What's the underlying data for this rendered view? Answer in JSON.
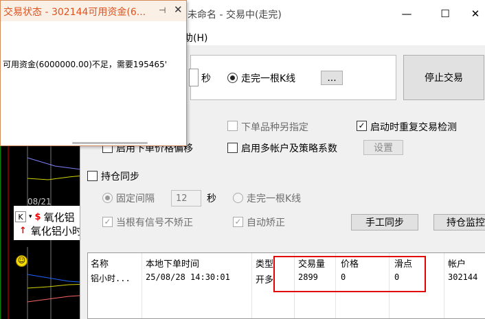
{
  "popup": {
    "title": "交易状态 - 302144可用资金(6...",
    "pin_glyph": "⊣",
    "close_glyph": "✕",
    "message": "可用资金(6000000.00)不足，需要195465'"
  },
  "main": {
    "title": "未命名 - 交易中(走完)",
    "menu_help": "助(H)",
    "minimize_glyph": "—",
    "maximize_glyph": "☐",
    "close_glyph": "✕",
    "sec_label": "秒",
    "bar_complete_label": "走完一根K线",
    "more_button": "...",
    "stop_button": "停止交易",
    "order_variety_label": "下单品种另指定",
    "restart_check_label": "启动时重复交易检测",
    "price_offset_label": "启用下单价格偏移",
    "multi_account_label": "启用多帐户及策略系数",
    "settings_button": "设置",
    "position_sync": {
      "label": "持仓同步",
      "fixed_interval_label": "固定间隔",
      "interval_value": "12",
      "sec_label": "秒",
      "bar_complete_label": "走完一根K线",
      "no_correct_label": "当根有信号不矫正",
      "auto_correct_label": "自动矫正",
      "manual_sync_button": "手工同步",
      "position_monitor_button": "持仓监控"
    },
    "check_mark": "✓",
    "table": {
      "headers": [
        "名称",
        "本地下单时间",
        "类型",
        "交易量",
        "价格",
        "滑点",
        "帐户"
      ],
      "rows": [
        [
          "铝小时...",
          "25/08/28 14:30:01",
          "开多",
          "2899",
          "0",
          "0",
          "302144"
        ]
      ]
    }
  },
  "background": {
    "date": "08/21",
    "k_label": "K",
    "dropdown_glyph": "▾",
    "s_label": "$",
    "name_1": "氧化铝",
    "name_2": "氧化铝小时",
    "arrow": "↑"
  }
}
